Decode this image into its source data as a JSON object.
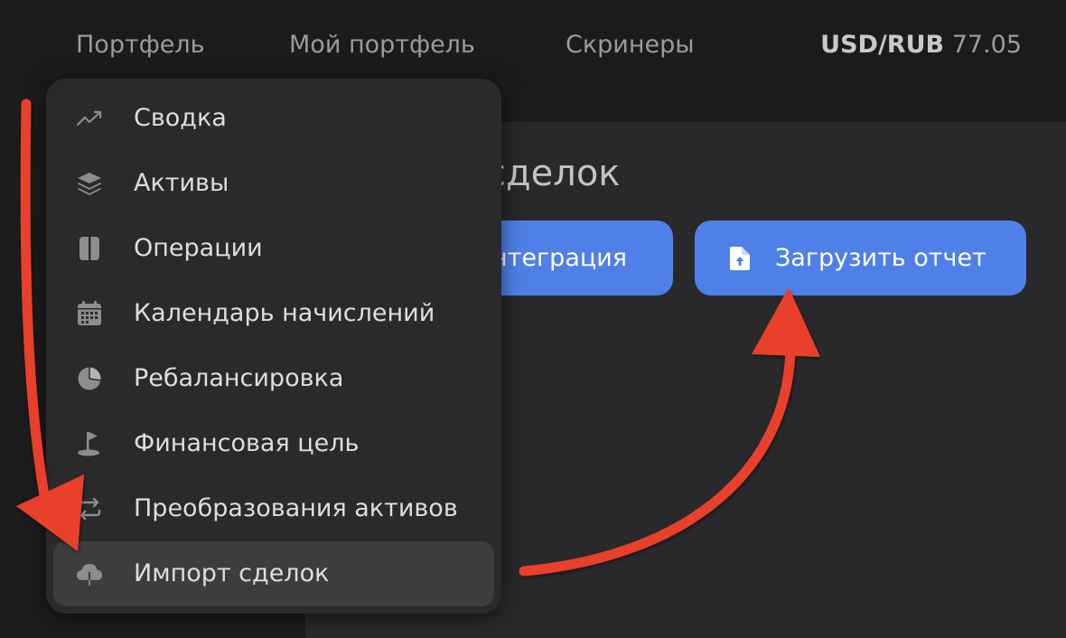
{
  "nav": {
    "portfolio": "Портфель",
    "my_portfolio": "Мой портфель",
    "screeners": "Скринеры",
    "rate_pair": "USD/RUB",
    "rate_value": "77.05"
  },
  "page": {
    "title_visible": "сделок",
    "integration_label": "нтеграция",
    "upload_label": "Загрузить отчет"
  },
  "menu": {
    "items": [
      {
        "label": "Сводка",
        "icon": "trending-up-icon"
      },
      {
        "label": "Активы",
        "icon": "layers-icon"
      },
      {
        "label": "Операции",
        "icon": "book-icon"
      },
      {
        "label": "Календарь начислений",
        "icon": "calendar-icon"
      },
      {
        "label": "Ребалансировка",
        "icon": "pie-chart-icon"
      },
      {
        "label": "Финансовая цель",
        "icon": "golf-flag-icon"
      },
      {
        "label": "Преобразования активов",
        "icon": "swap-arrows-icon"
      },
      {
        "label": "Импорт сделок",
        "icon": "cloud-download-icon"
      }
    ],
    "active_index": 7
  },
  "colors": {
    "accent": "#4f80e8",
    "arrow": "#e8412b",
    "menu_bg": "#2a2a2c",
    "menu_active_bg": "#3d3d40"
  }
}
